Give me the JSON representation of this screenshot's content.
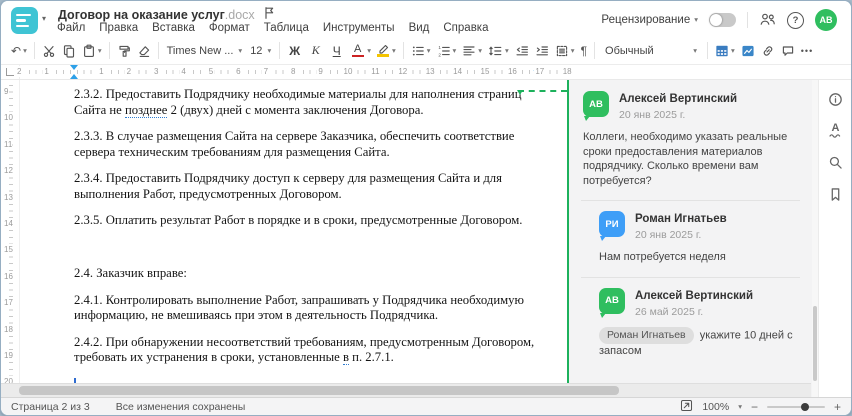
{
  "colors": {
    "green": "#2fbe5f",
    "blue": "#3e9ef7",
    "teal_logo": "#3fc4d4",
    "comment_green": "#1db15c",
    "icon_blue": "#3a7cc0",
    "marker_blue": "#2da0e8",
    "font_color_bar": "#cc2222",
    "highlight_bar": "#f4c400"
  },
  "icons": {
    "dropdown_caret": "▾",
    "undo": "↶",
    "pilcrow": "¶",
    "more": "•••",
    "help": "?",
    "spell_letter": "А"
  },
  "header": {
    "title": "Договор на оказание услуг",
    "title_ext": ".docx",
    "menu": [
      "Файл",
      "Правка",
      "Вставка",
      "Формат",
      "Таблица",
      "Инструменты",
      "Вид",
      "Справка"
    ],
    "review_label": "Рецензирование",
    "avatar_initials": "АВ"
  },
  "toolbar": {
    "font_name": "Times New ...",
    "font_size": "12",
    "bold": "Ж",
    "italic": "К",
    "underline": "Ч",
    "font_color": "А",
    "style_name": "Обычный"
  },
  "ruler": {
    "horizontal": [
      {
        "label": "2",
        "cm": -2
      },
      {
        "label": "1",
        "cm": -1
      },
      {
        "label": "1",
        "cm": 1
      },
      {
        "label": "2",
        "cm": 2
      },
      {
        "label": "3",
        "cm": 3
      },
      {
        "label": "4",
        "cm": 4
      },
      {
        "label": "5",
        "cm": 5
      },
      {
        "label": "6",
        "cm": 6
      },
      {
        "label": "7",
        "cm": 7
      },
      {
        "label": "8",
        "cm": 8
      },
      {
        "label": "9",
        "cm": 9
      },
      {
        "label": "10",
        "cm": 10
      },
      {
        "label": "11",
        "cm": 11
      },
      {
        "label": "12",
        "cm": 12
      },
      {
        "label": "13",
        "cm": 13
      },
      {
        "label": "14",
        "cm": 14
      },
      {
        "label": "15",
        "cm": 15
      },
      {
        "label": "16",
        "cm": 16
      },
      {
        "label": "17",
        "cm": 17
      },
      {
        "label": "18",
        "cm": 18
      }
    ],
    "vertical": [
      "9",
      "10",
      "11",
      "12",
      "13",
      "14",
      "15",
      "16",
      "17",
      "18",
      "19",
      "20"
    ]
  },
  "document": {
    "paragraphs": [
      {
        "segments": [
          {
            "t": "2.3.2. Предоставить Подрядчику необходимые материалы для наполнения страниц Сайта не "
          },
          {
            "t": "позднее",
            "u": true
          },
          {
            "t": " 2 (двух) дней с момента заключения Договора."
          }
        ]
      },
      {
        "text": "2.3.3. В случае размещения Сайта на сервере Заказчика, обеспечить соответствие сервера техническим требованиям для размещения Сайта."
      },
      {
        "text": "2.3.4. Предоставить Подрядчику доступ к серверу для размещения Сайта и для выполнения Работ, предусмотренных Договором."
      },
      {
        "text": "2.3.5. Оплатить результат Работ в порядке и в сроки, предусмотренные Договором."
      },
      {
        "text": " ",
        "cls": "blank"
      },
      {
        "text": "2.4. Заказчик вправе:"
      },
      {
        "text": "2.4.1. Контролировать выполнение Работ, запрашивать у Подрядчика необходимую информацию, не вмешиваясь при этом в деятельность Подрядчика."
      },
      {
        "segments": [
          {
            "t": "2.4.2. При обнаружении несоответствий требованиям, предусмотренным Договором, требовать их устранения в сроки, установленные "
          },
          {
            "t": "в",
            "u": true
          },
          {
            "t": " п. 2.7.1."
          }
        ]
      }
    ]
  },
  "comments": {
    "items": [
      {
        "initials": "АВ",
        "color": "green",
        "name": "Алексей Вертинский",
        "date": "20 янв 2025 г.",
        "text": "Коллеги, необходимо указать реальные сроки предоставления материалов подрядчику. Сколько времени вам потребуется?"
      },
      {
        "initials": "РИ",
        "color": "blue",
        "name": "Роман Игнатьев",
        "date": "20 янв 2025 г.",
        "text": "Нам потребуется неделя",
        "reply": true
      },
      {
        "initials": "АВ",
        "color": "green",
        "name": "Алексей Вертинский",
        "date": "26 май 2025 г.",
        "mention": "Роман Игнатьев",
        "text": "укажите 10 дней с запасом",
        "reply": true
      }
    ]
  },
  "statusbar": {
    "page_label": "Страница 2 из 3",
    "saved_label": "Все изменения сохранены",
    "zoom_value": "100%"
  }
}
